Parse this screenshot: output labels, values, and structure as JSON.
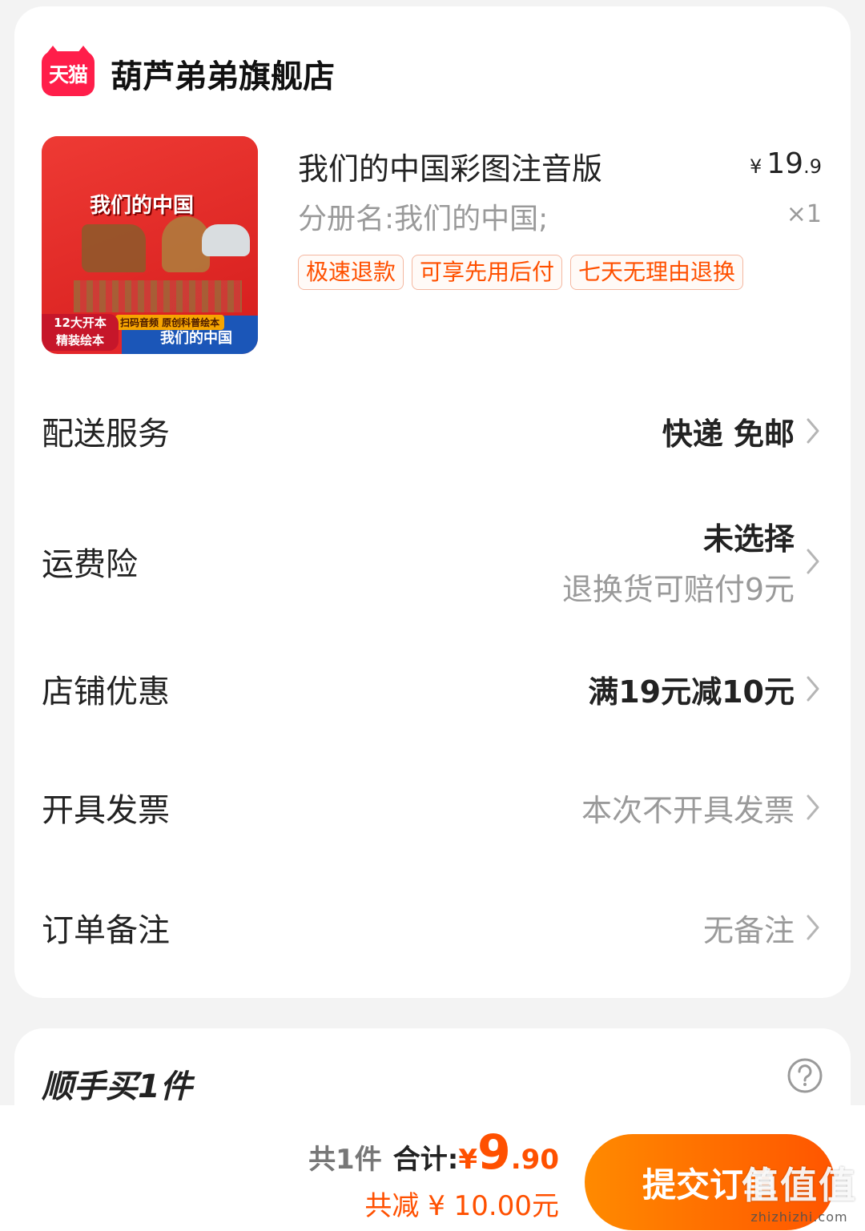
{
  "store": {
    "badge": "天猫",
    "name": "葫芦弟弟旗舰店"
  },
  "product": {
    "cover_title": "我们的中国",
    "cover_band_label": "我们的中国",
    "cover_band_sub": "扫码音频 原创科普绘本",
    "cover_corner_1": "12大开本",
    "cover_corner_2": "精装绘本",
    "title": "我们的中国彩图注音版",
    "price_symbol": "¥",
    "price_int": "19",
    "price_dec": ".9",
    "variant": "分册名:我们的中国;",
    "quantity": "×1",
    "tags": [
      "极速退款",
      "可享先用后付",
      "七天无理由退换"
    ]
  },
  "rows": {
    "delivery": {
      "label": "配送服务",
      "value": "快递 免邮"
    },
    "insurance": {
      "label": "运费险",
      "value": "未选择",
      "sub": "退换货可赔付9元"
    },
    "promo": {
      "label": "店铺优惠",
      "value": "满19元减10元"
    },
    "invoice": {
      "label": "开具发票",
      "value": "本次不开具发票"
    },
    "note": {
      "label": "订单备注",
      "value": "无备注"
    }
  },
  "addon": {
    "title": "顺手买1件"
  },
  "bottom": {
    "count": "共1件",
    "sum_label": "合计:",
    "sum_yen": "¥",
    "sum_int": "9",
    "sum_dec": ".90",
    "discount": "共减 ¥ 10.00元",
    "submit": "提交订单"
  },
  "watermark": {
    "main": "值值值",
    "sub": "zhizhizhi.com"
  },
  "colors": {
    "accent": "#ff5000",
    "tmall_red": "#ff1e4a",
    "tag_border": "#f4b7a0",
    "button_start": "#ff8a00",
    "button_end": "#ff5500"
  }
}
